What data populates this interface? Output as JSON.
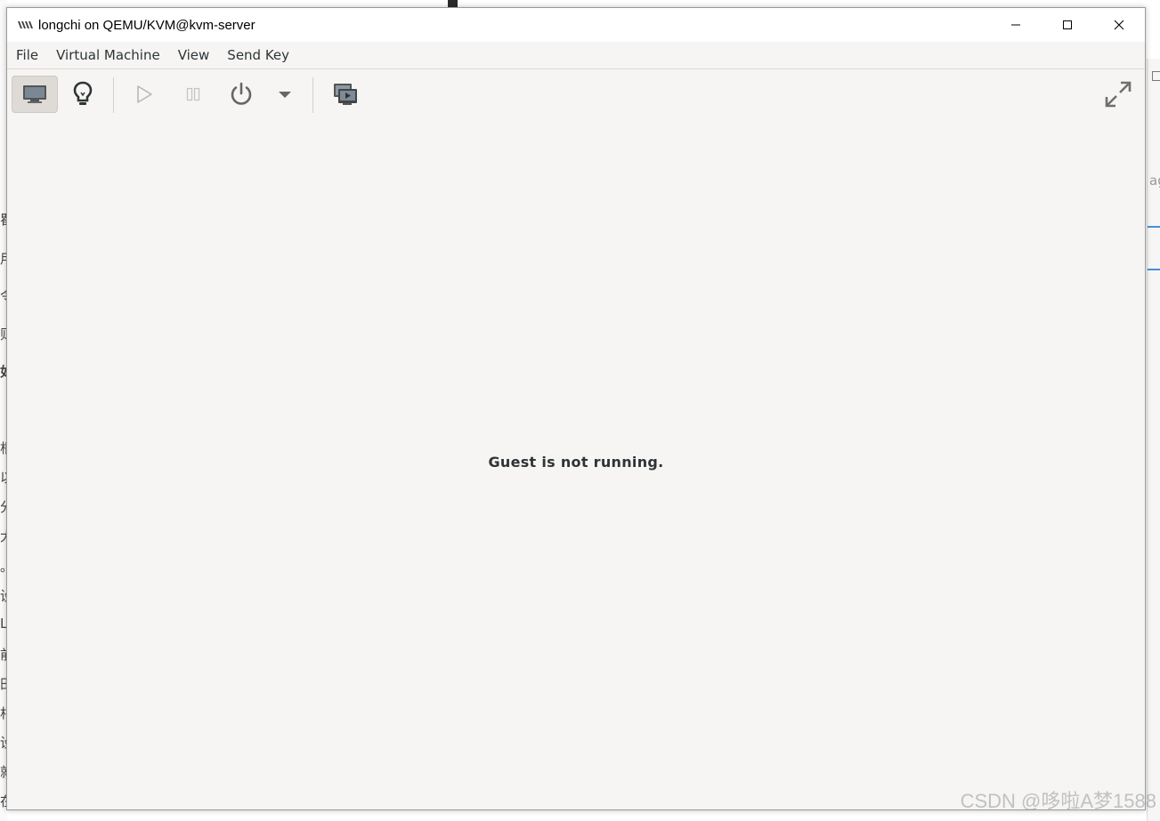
{
  "window": {
    "title": "longchi on QEMU/KVM@kvm-server"
  },
  "menubar": {
    "items": [
      "File",
      "Virtual Machine",
      "View",
      "Send Key"
    ]
  },
  "toolbar": {
    "buttons": [
      {
        "name": "console",
        "icon": "monitor-icon",
        "active": true
      },
      {
        "name": "details",
        "icon": "lightbulb-icon",
        "active": false
      },
      {
        "name": "run",
        "icon": "play-icon",
        "enabled": false
      },
      {
        "name": "pause",
        "icon": "pause-icon",
        "enabled": false
      },
      {
        "name": "shutdown",
        "icon": "power-icon"
      },
      {
        "name": "shutdown-menu",
        "icon": "chevron-down-icon"
      },
      {
        "name": "snapshots",
        "icon": "snapshot-icon"
      },
      {
        "name": "fullscreen",
        "icon": "fullscreen-icon"
      }
    ]
  },
  "content": {
    "status": "Guest is not running."
  },
  "watermark": "CSDN @哆啦A梦1588",
  "background": {
    "left_glyphs": [
      "刂",
      "瞿",
      "用",
      "令",
      "则",
      "如",
      "根",
      "以",
      "分",
      "大",
      "。",
      "设",
      "L",
      "前",
      "田",
      "相",
      "设",
      "就",
      "在"
    ],
    "right_fragment": "ag"
  },
  "colors": {
    "window_bg": "#f6f5f4",
    "titlebar_bg": "#ffffff",
    "text": "#2e3436",
    "accent_line": "#4a8fd6"
  }
}
